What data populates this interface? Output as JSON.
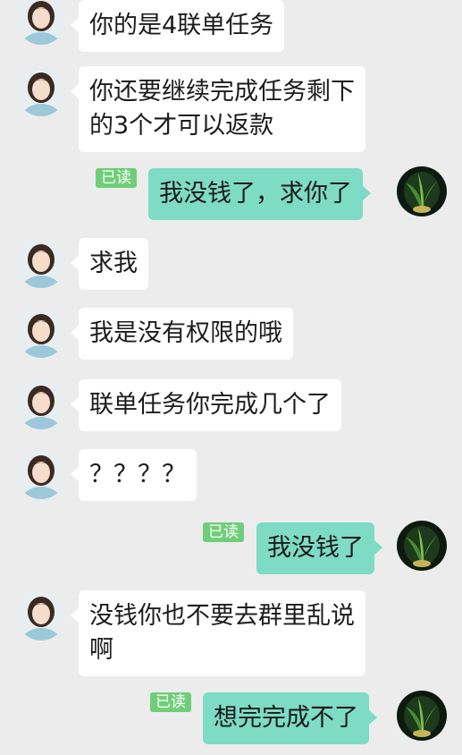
{
  "colors": {
    "background": "#ececec",
    "incoming_bubble": "#ffffff",
    "outgoing_bubble": "#7ddbc6",
    "read_badge": "#6fce78"
  },
  "icons": {
    "contact_avatar": "woman-portrait-avatar",
    "self_avatar": "green-plant-avatar"
  },
  "messages": [
    {
      "side": "incoming",
      "lines": [
        "你的是4联单任务"
      ]
    },
    {
      "side": "incoming",
      "lines": [
        "你还要继续完成任务剩下",
        "的3个才可以返款"
      ]
    },
    {
      "side": "outgoing",
      "read_label": "已读",
      "lines": [
        "我没钱了，求你了"
      ]
    },
    {
      "side": "incoming",
      "lines": [
        "求我"
      ]
    },
    {
      "side": "incoming",
      "lines": [
        "我是没有权限的哦"
      ]
    },
    {
      "side": "incoming",
      "lines": [
        "联单任务你完成几个了"
      ]
    },
    {
      "side": "incoming",
      "lines": [
        "？？？？"
      ]
    },
    {
      "side": "outgoing",
      "read_label": "已读",
      "lines": [
        "我没钱了"
      ]
    },
    {
      "side": "incoming",
      "lines": [
        "没钱你也不要去群里乱说",
        "啊"
      ]
    },
    {
      "side": "outgoing",
      "read_label": "已读",
      "lines": [
        "想完完成不了"
      ]
    }
  ]
}
